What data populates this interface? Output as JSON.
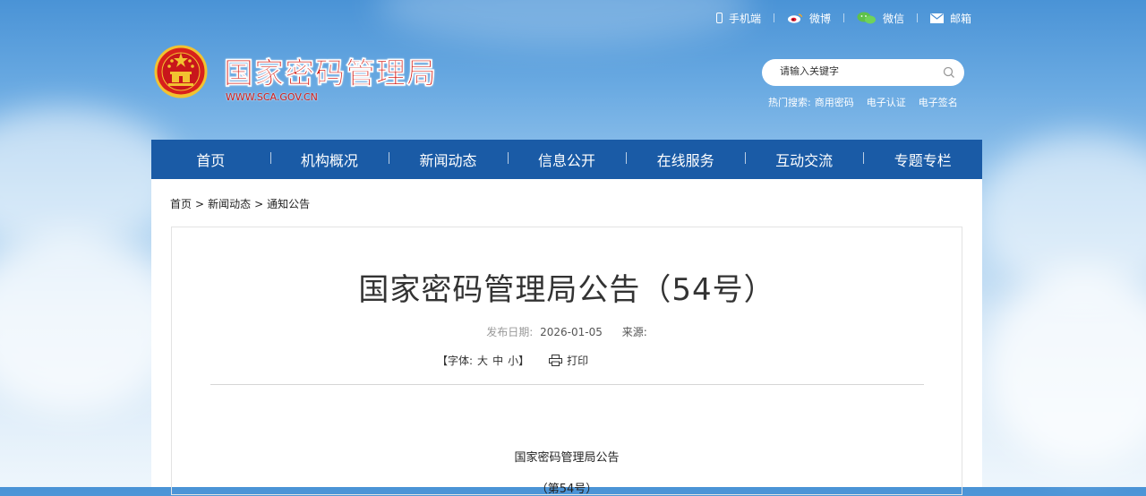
{
  "top_links": {
    "mobile": "手机端",
    "weibo": "微博",
    "wechat": "微信",
    "mail": "邮箱"
  },
  "header": {
    "site_title": "国家密码管理局",
    "site_url": "WWW.SCA.GOV.CN",
    "search_placeholder": "请输入关键字",
    "hot_label": "热门搜索:",
    "hot_keywords": [
      "商用密码",
      "电子认证",
      "电子签名"
    ]
  },
  "nav": {
    "items": [
      "首页",
      "机构概况",
      "新闻动态",
      "信息公开",
      "在线服务",
      "互动交流",
      "专题专栏"
    ],
    "bg_color": "#1a5ba6"
  },
  "breadcrumb": {
    "items": [
      "首页",
      "新闻动态",
      "通知公告"
    ],
    "separator": ">"
  },
  "article": {
    "title": "国家密码管理局公告（54号）",
    "date_label": "发布日期:",
    "date": "2026-01-05",
    "source_label": "来源:",
    "font_label": "【字体:",
    "font_large": "大",
    "font_medium": "中",
    "font_small": "小】",
    "print_label": "打印",
    "body_title": "国家密码管理局公告",
    "body_subtitle": "（第54号）"
  },
  "colors": {
    "title_red": "#d4201a",
    "nav_blue": "#1a5ba6"
  },
  "icons": [
    "phone-icon",
    "weibo-icon",
    "wechat-icon",
    "mail-icon",
    "search-icon",
    "print-icon",
    "national-emblem"
  ]
}
